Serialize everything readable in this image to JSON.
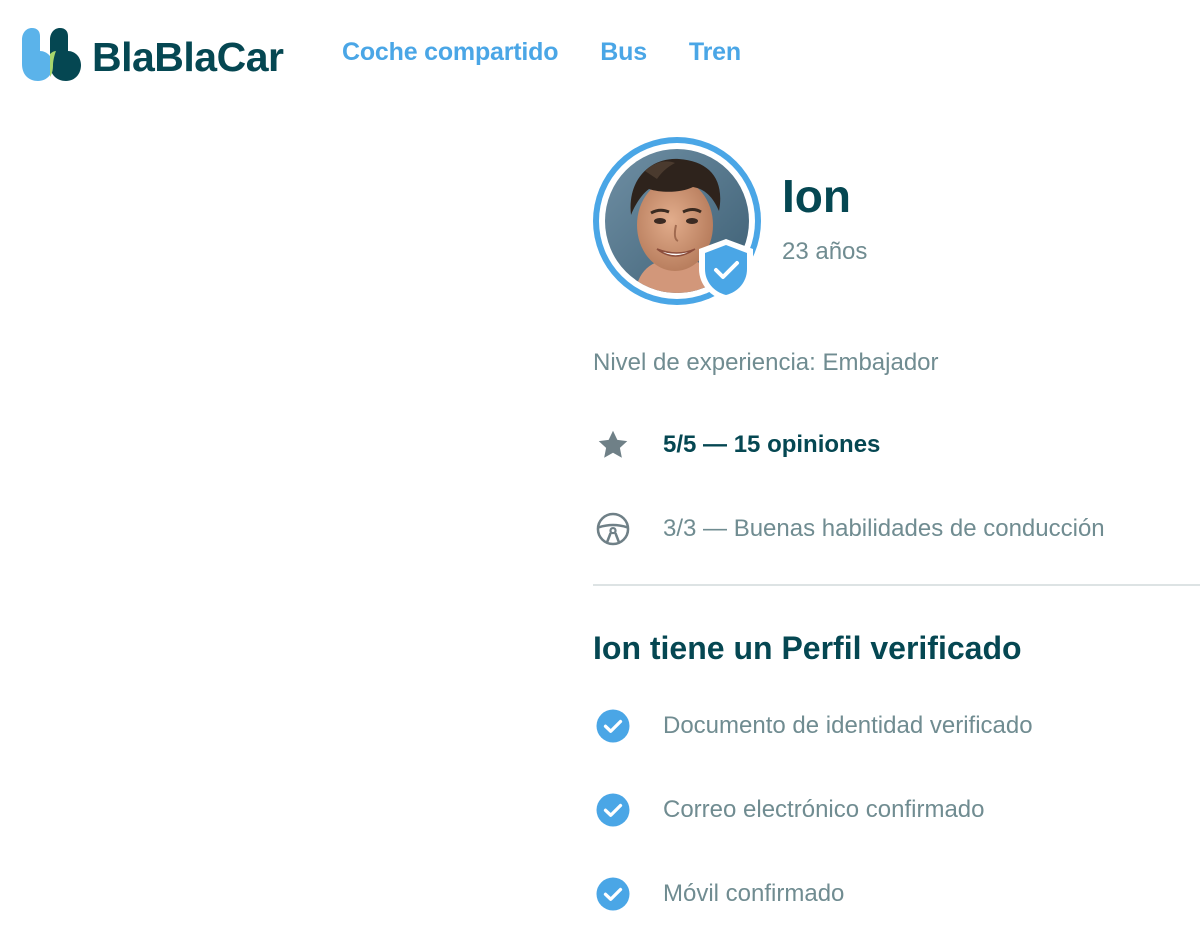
{
  "header": {
    "logo_text": "BlaBlaCar",
    "nav": [
      {
        "label": "Coche compartido"
      },
      {
        "label": "Bus"
      },
      {
        "label": "Tren"
      }
    ]
  },
  "profile": {
    "name": "Ion",
    "age": "23 años",
    "experience": "Nivel de experiencia: Embajador",
    "rating": "5/5 — 15 opiniones",
    "driving": "3/3 — Buenas habilidades de conducción"
  },
  "verification": {
    "title": "Ion tiene un Perfil verificado",
    "items": [
      {
        "label": "Documento de identidad verificado"
      },
      {
        "label": "Correo electrónico confirmado"
      },
      {
        "label": "Móvil confirmado"
      }
    ]
  },
  "colors": {
    "brand_dark": "#054752",
    "accent_blue": "#4aa6e6",
    "muted_text": "#708c91",
    "icon_gray": "#6f8087",
    "divider": "#dde3e4"
  },
  "icons": {
    "logo": "blablacar-logo-icon",
    "verified": "verified-shield-icon",
    "rating": "star-icon",
    "driving": "steering-wheel-icon",
    "check": "check-circle-icon"
  }
}
